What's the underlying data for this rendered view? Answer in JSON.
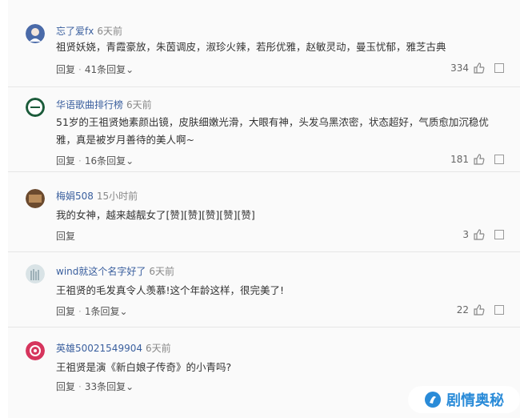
{
  "comments": [
    {
      "user": "忘了爱fx",
      "time": "6天前",
      "text": "祖贤妖娆，青霞豪放，朱茵调皮，淑珍火辣，若彤优雅，赵敏灵动，曼玉忧郁，雅芝古典",
      "reply_label": "回复",
      "replies_label": "41条回复",
      "likes": "334"
    },
    {
      "user": "华语歌曲排行榜",
      "time": "6天前",
      "text": "51岁的王祖贤她素颜出镜，皮肤细嫩光滑，大眼有神，头发乌黑浓密，状态超好，气质愈加沉稳优雅，真是被岁月善待的美人啊~",
      "reply_label": "回复",
      "replies_label": "16条回复",
      "likes": "181"
    },
    {
      "user": "梅娟508",
      "time": "15小时前",
      "text": "我的女神，越来越靓女了[赞][赞][赞][赞][赞]",
      "reply_label": "回复",
      "replies_label": "",
      "likes": "3"
    },
    {
      "user": "wind就这个名字好了",
      "time": "6天前",
      "text": "王祖贤的毛发真令人羡慕!这个年龄这样，很完美了!",
      "reply_label": "回复",
      "replies_label": "1条回复",
      "likes": "22"
    },
    {
      "user": "英雄50021549904",
      "time": "6天前",
      "text": "王祖贤是演《新白娘子传奇》的小青吗?",
      "reply_label": "回复",
      "replies_label": "33条回复",
      "likes": ""
    }
  ],
  "watermark": {
    "text": "剧情奥秘"
  }
}
